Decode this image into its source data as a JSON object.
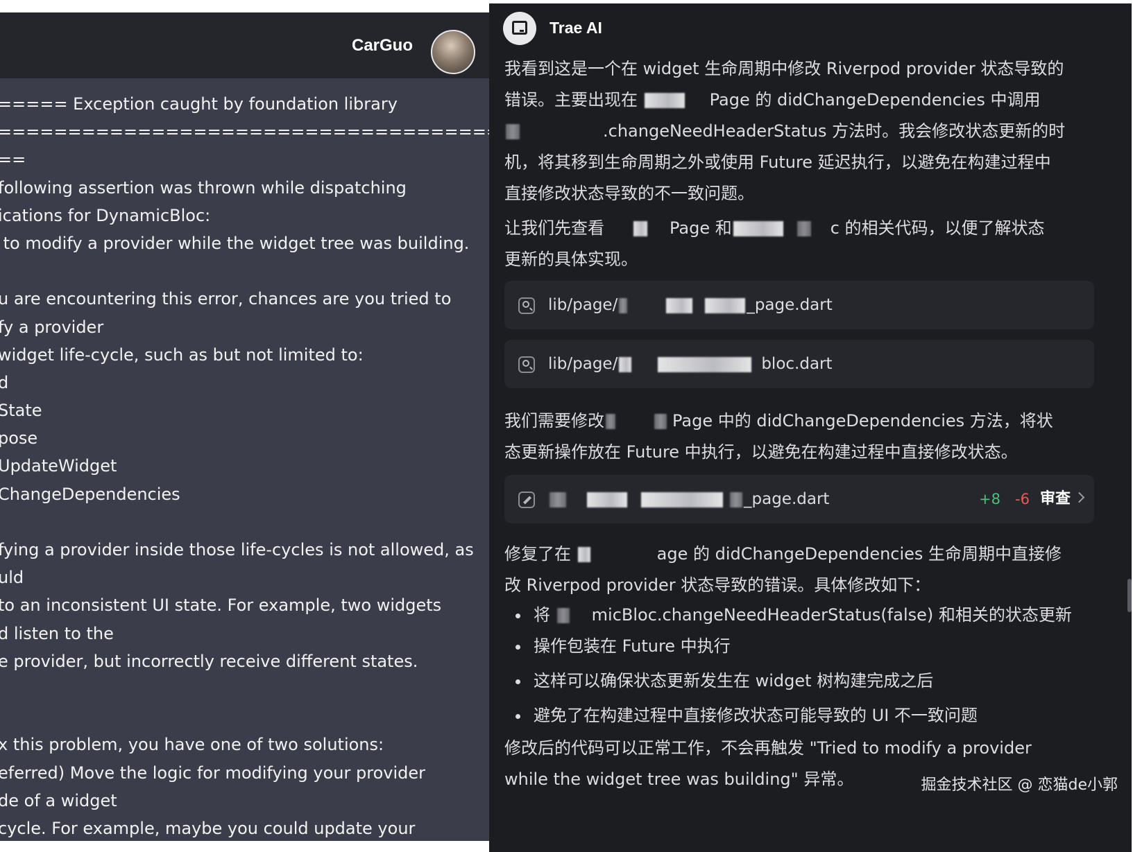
{
  "left": {
    "username": "CarGuo",
    "lines": [
      "===== Exception caught by foundation library",
      "================================================",
      "==",
      "following assertion was thrown while dispatching",
      "ications for DynamicBloc:",
      " to modify a provider while the widget tree was building.",
      "",
      "u are encountering this error, chances are you tried to",
      "fy a provider",
      "widget life-cycle, such as but not limited to:",
      "d",
      "State",
      "pose",
      "UpdateWidget",
      "ChangeDependencies",
      "",
      "fying a provider inside those life-cycles is not allowed, as",
      "uld",
      "to an inconsistent UI state. For example, two widgets",
      "d listen to the",
      "e provider, but incorrectly receive different states.",
      "",
      "",
      "x this problem, you have one of two solutions:",
      "eferred) Move the logic for modifying your provider",
      "de of a widget",
      "cycle. For example, maybe you could update your"
    ]
  },
  "assistant": {
    "name": "Trae AI",
    "intro": {
      "l1": "我看到这是一个在 widget 生命周期中修改 Riverpod provider 状态导致的",
      "l2a": "错误。主要出现在",
      "l2b": "Page 的 didChangeDependencies 中调用",
      "l3b": ".changeNeedHeaderStatus 方法时。我会修改状态更新的时",
      "l4": "机，将其移到生命周期之外或使用 Future 延迟执行，以避免在构建过程中",
      "l5": "直接修改状态导致的不一致问题。"
    },
    "check": {
      "l1a": "让我们先查看",
      "l1b": "Page 和",
      "l1c": "c 的相关代码，以便了解状态",
      "l2": "更新的具体实现。"
    },
    "file1": {
      "prefix": "lib/page/",
      "suffix": "_page.dart"
    },
    "file2": {
      "prefix": "lib/page/",
      "suffix": "bloc.dart"
    },
    "need": {
      "l1a": "我们需要修改",
      "l1b": "Page 中的 didChangeDependencies 方法，将状",
      "l2": "态更新操作放在 Future 中执行，以避免在构建过程中直接修改状态。"
    },
    "edit": {
      "suffix": "_page.dart",
      "added": "+8",
      "removed": "-6",
      "review": "审查"
    },
    "fixed": {
      "l1a": "修复了在",
      "l1b": "age 的 didChangeDependencies 生命周期中直接修",
      "l2": "改 Riverpod provider 状态导致的错误。具体修改如下："
    },
    "bullets": {
      "b1a": "将",
      "b1b": "micBloc.changeNeedHeaderStatus(false) 和相关的状态更新",
      "b1c": "操作包装在 Future 中执行",
      "b2": "这样可以确保状态更新发生在 widget 树构建完成之后",
      "b3": "避免了在构建过程中直接修改状态可能导致的 UI 不一致问题"
    },
    "final": {
      "l1": "修改后的代码可以正常工作，不会再触发 \"Tried to modify a provider",
      "l2": "while the widget tree was building\" 异常。"
    }
  },
  "watermark": "掘金技术社区 @ 恋猫de小郭"
}
